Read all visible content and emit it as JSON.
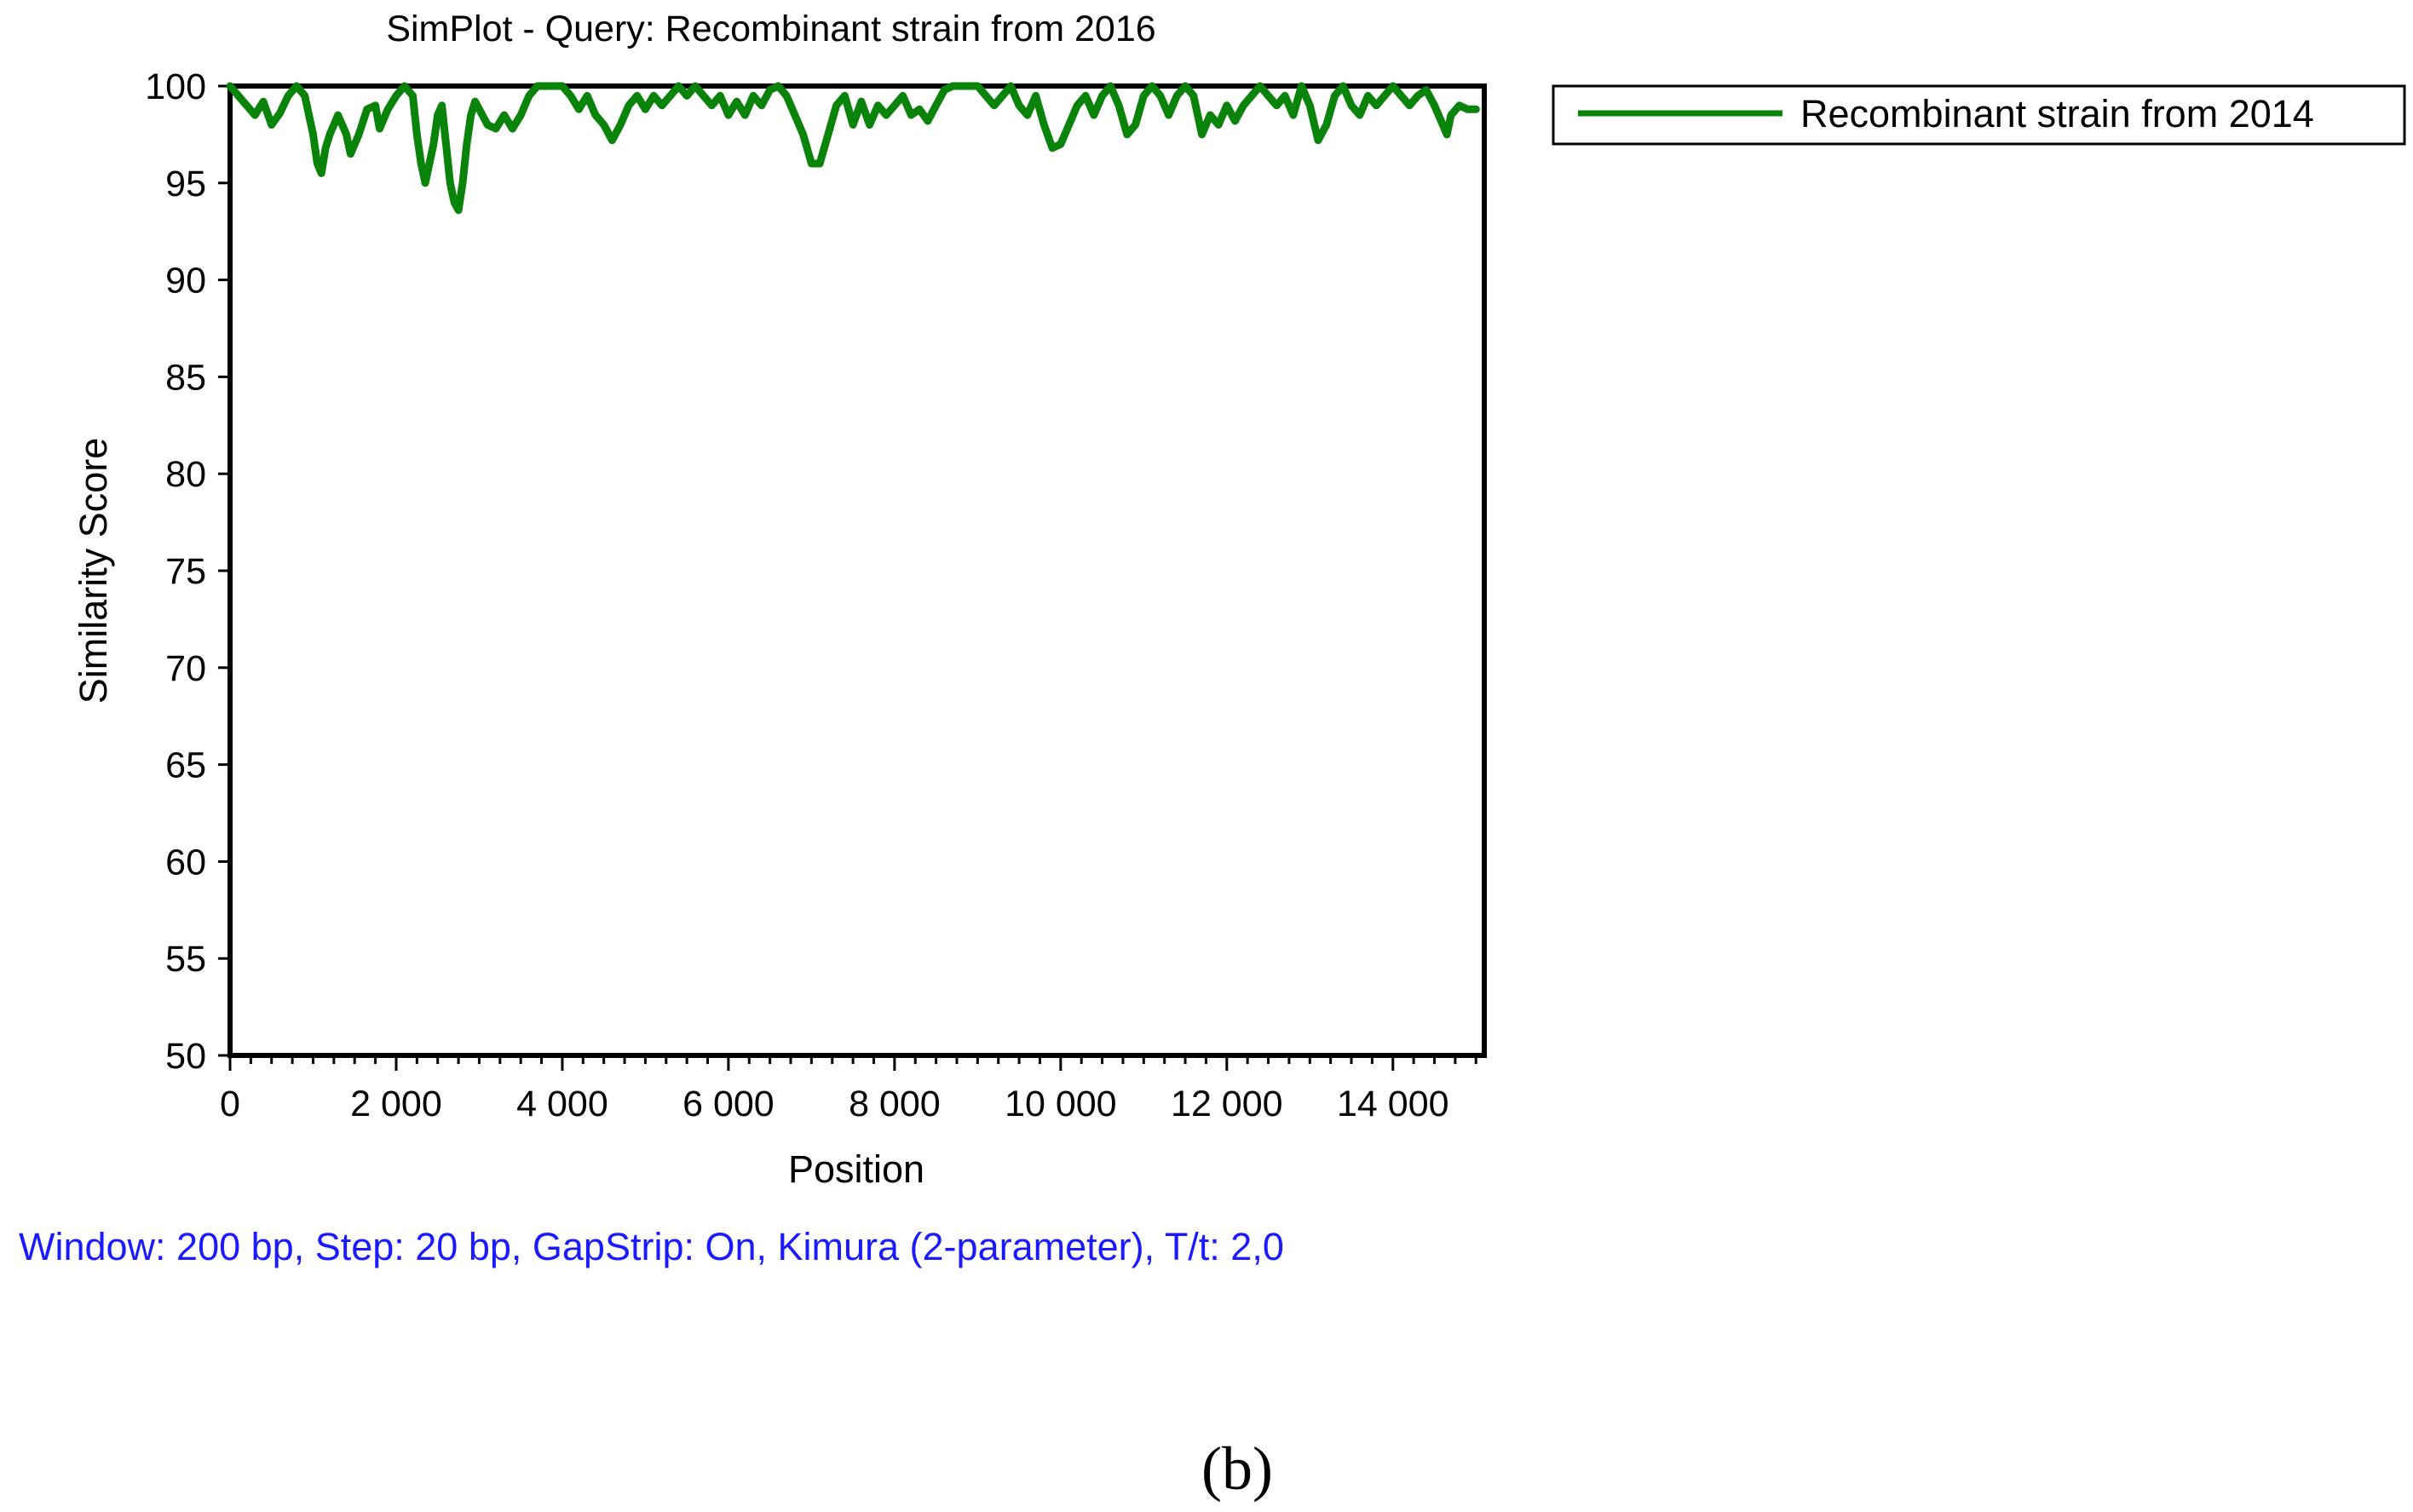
{
  "caption": "(b)",
  "params_note": "Window: 200 bp, Step: 20 bp, GapStrip: On, Kimura (2-parameter), T/t: 2,0",
  "colors": {
    "series": "#0a830a",
    "params_text": "#1a1aff",
    "axis": "#000000"
  },
  "chart_data": {
    "type": "line",
    "title": "SimPlot - Query: Recombinant strain from 2016",
    "xlabel": "Position",
    "ylabel": "Similarity Score",
    "xlim": [
      0,
      15100
    ],
    "ylim": [
      50,
      100
    ],
    "x_ticks": [
      0,
      2000,
      4000,
      6000,
      8000,
      10000,
      12000,
      14000
    ],
    "x_tick_labels": [
      "0",
      "2 000",
      "4 000",
      "6 000",
      "8 000",
      "10 000",
      "12 000",
      "14 000"
    ],
    "y_ticks": [
      50,
      55,
      60,
      65,
      70,
      75,
      80,
      85,
      90,
      95,
      100
    ],
    "y_tick_labels": [
      "50",
      "55",
      "60",
      "65",
      "70",
      "75",
      "80",
      "85",
      "90",
      "95",
      "100"
    ],
    "grid": false,
    "legend_position": "outside-top-right",
    "series": [
      {
        "name": "Recombinant strain from 2014",
        "color": "#0a830a",
        "points": [
          [
            0,
            100
          ],
          [
            100,
            99.5
          ],
          [
            200,
            99
          ],
          [
            300,
            98.5
          ],
          [
            400,
            99.2
          ],
          [
            500,
            98
          ],
          [
            600,
            98.6
          ],
          [
            700,
            99.5
          ],
          [
            800,
            100
          ],
          [
            900,
            99.5
          ],
          [
            1000,
            97.5
          ],
          [
            1050,
            96
          ],
          [
            1100,
            95.5
          ],
          [
            1150,
            96.8
          ],
          [
            1200,
            97.5
          ],
          [
            1300,
            98.5
          ],
          [
            1400,
            97.5
          ],
          [
            1450,
            96.5
          ],
          [
            1550,
            97.5
          ],
          [
            1650,
            98.8
          ],
          [
            1750,
            99
          ],
          [
            1800,
            97.8
          ],
          [
            1900,
            98.8
          ],
          [
            2000,
            99.5
          ],
          [
            2100,
            100
          ],
          [
            2200,
            99.5
          ],
          [
            2250,
            97.5
          ],
          [
            2300,
            96
          ],
          [
            2350,
            95
          ],
          [
            2450,
            97
          ],
          [
            2500,
            98.5
          ],
          [
            2550,
            99
          ],
          [
            2600,
            97
          ],
          [
            2650,
            95
          ],
          [
            2700,
            94
          ],
          [
            2750,
            93.6
          ],
          [
            2800,
            95
          ],
          [
            2850,
            97
          ],
          [
            2900,
            98.5
          ],
          [
            2950,
            99.2
          ],
          [
            3000,
            98.8
          ],
          [
            3100,
            98
          ],
          [
            3200,
            97.8
          ],
          [
            3300,
            98.5
          ],
          [
            3400,
            97.8
          ],
          [
            3500,
            98.5
          ],
          [
            3600,
            99.5
          ],
          [
            3700,
            100
          ],
          [
            3800,
            100
          ],
          [
            3900,
            100
          ],
          [
            4000,
            100
          ],
          [
            4100,
            99.5
          ],
          [
            4200,
            98.8
          ],
          [
            4300,
            99.5
          ],
          [
            4400,
            98.5
          ],
          [
            4500,
            98
          ],
          [
            4600,
            97.2
          ],
          [
            4700,
            98
          ],
          [
            4800,
            99
          ],
          [
            4900,
            99.5
          ],
          [
            5000,
            98.8
          ],
          [
            5100,
            99.5
          ],
          [
            5200,
            99
          ],
          [
            5300,
            99.5
          ],
          [
            5400,
            100
          ],
          [
            5500,
            99.5
          ],
          [
            5600,
            100
          ],
          [
            5700,
            99.5
          ],
          [
            5800,
            99
          ],
          [
            5900,
            99.5
          ],
          [
            6000,
            98.5
          ],
          [
            6100,
            99.2
          ],
          [
            6200,
            98.5
          ],
          [
            6300,
            99.5
          ],
          [
            6400,
            99
          ],
          [
            6500,
            99.8
          ],
          [
            6600,
            100
          ],
          [
            6700,
            99.5
          ],
          [
            6800,
            98.5
          ],
          [
            6900,
            97.5
          ],
          [
            7000,
            96
          ],
          [
            7100,
            96
          ],
          [
            7200,
            97.5
          ],
          [
            7300,
            99
          ],
          [
            7400,
            99.5
          ],
          [
            7500,
            98
          ],
          [
            7600,
            99.2
          ],
          [
            7700,
            98
          ],
          [
            7800,
            99
          ],
          [
            7900,
            98.5
          ],
          [
            8000,
            99
          ],
          [
            8100,
            99.5
          ],
          [
            8200,
            98.5
          ],
          [
            8300,
            98.8
          ],
          [
            8400,
            98.2
          ],
          [
            8500,
            99
          ],
          [
            8600,
            99.8
          ],
          [
            8700,
            100
          ],
          [
            8800,
            100
          ],
          [
            8900,
            100
          ],
          [
            9000,
            100
          ],
          [
            9100,
            99.5
          ],
          [
            9200,
            99
          ],
          [
            9300,
            99.5
          ],
          [
            9400,
            100
          ],
          [
            9500,
            99
          ],
          [
            9600,
            98.5
          ],
          [
            9700,
            99.5
          ],
          [
            9800,
            98
          ],
          [
            9900,
            96.8
          ],
          [
            10000,
            97
          ],
          [
            10100,
            98
          ],
          [
            10200,
            99
          ],
          [
            10300,
            99.5
          ],
          [
            10400,
            98.5
          ],
          [
            10500,
            99.5
          ],
          [
            10600,
            100
          ],
          [
            10700,
            99
          ],
          [
            10800,
            97.5
          ],
          [
            10900,
            98
          ],
          [
            11000,
            99.5
          ],
          [
            11100,
            100
          ],
          [
            11200,
            99.5
          ],
          [
            11300,
            98.5
          ],
          [
            11400,
            99.5
          ],
          [
            11500,
            100
          ],
          [
            11600,
            99.5
          ],
          [
            11700,
            97.5
          ],
          [
            11800,
            98.5
          ],
          [
            11900,
            98
          ],
          [
            12000,
            99
          ],
          [
            12100,
            98.2
          ],
          [
            12200,
            99
          ],
          [
            12300,
            99.5
          ],
          [
            12400,
            100
          ],
          [
            12500,
            99.5
          ],
          [
            12600,
            99
          ],
          [
            12700,
            99.5
          ],
          [
            12800,
            98.5
          ],
          [
            12900,
            100
          ],
          [
            13000,
            99
          ],
          [
            13100,
            97.2
          ],
          [
            13200,
            98
          ],
          [
            13300,
            99.5
          ],
          [
            13400,
            100
          ],
          [
            13500,
            99
          ],
          [
            13600,
            98.5
          ],
          [
            13700,
            99.5
          ],
          [
            13800,
            99
          ],
          [
            13900,
            99.5
          ],
          [
            14000,
            100
          ],
          [
            14100,
            99.5
          ],
          [
            14200,
            99
          ],
          [
            14300,
            99.5
          ],
          [
            14400,
            99.8
          ],
          [
            14500,
            99
          ],
          [
            14600,
            98
          ],
          [
            14650,
            97.5
          ],
          [
            14700,
            98.5
          ],
          [
            14800,
            99
          ],
          [
            14900,
            98.8
          ],
          [
            15000,
            98.8
          ]
        ]
      }
    ]
  }
}
